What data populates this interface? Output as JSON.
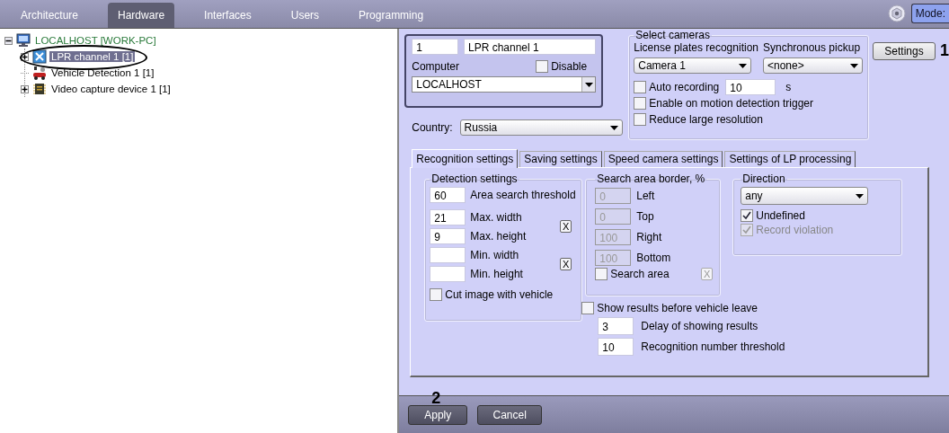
{
  "top_tabs": [
    {
      "label": "Architecture",
      "selected": false
    },
    {
      "label": "Hardware",
      "selected": true
    },
    {
      "label": "Interfaces",
      "selected": false
    },
    {
      "label": "Users",
      "selected": false
    },
    {
      "label": "Programming",
      "selected": false
    }
  ],
  "mode_button": {
    "label": "Mode:"
  },
  "tree": [
    {
      "label": "LOCALHOST [WORK-PC]",
      "kind": "computer",
      "expanded": true,
      "selected": false,
      "children": [
        {
          "label": "LPR channel 1 [1]",
          "kind": "lpr",
          "expandable": true,
          "expanded": false,
          "selected": true,
          "circled": true
        },
        {
          "label": "Vehicle Detection 1 [1]",
          "kind": "vehicle",
          "expandable": false,
          "selected": false,
          "circled": false
        },
        {
          "label": "Video capture device 1 [1]",
          "kind": "chip",
          "expandable": true,
          "expanded": false,
          "selected": false,
          "circled": false
        }
      ]
    }
  ],
  "object": {
    "number": "1",
    "name": "LPR channel 1",
    "computer_label": "Computer",
    "disable": {
      "label": "Disable",
      "checked": false
    },
    "computer": "LOCALHOST"
  },
  "country": {
    "label": "Country:",
    "value": "Russia"
  },
  "select_cameras": {
    "title": "Select cameras",
    "lpr_label": "License plates recognition",
    "lpr_value": "Camera 1",
    "sync_label": "Synchronous pickup",
    "sync_value": "<none>",
    "auto_recording": {
      "label": "Auto recording",
      "checked": false,
      "value": "10",
      "unit": "s"
    },
    "motion_trigger": {
      "label": "Enable on motion detection trigger",
      "checked": false
    },
    "reduce_resolution": {
      "label": "Reduce large resolution",
      "checked": false
    }
  },
  "settings_button": {
    "label": "Settings"
  },
  "settings_tabs": [
    {
      "label": "Recognition settings",
      "selected": true
    },
    {
      "label": "Saving settings",
      "selected": false
    },
    {
      "label": "Speed camera settings",
      "selected": false
    },
    {
      "label": "Settings of LP processing",
      "selected": false
    }
  ],
  "detection": {
    "title": "Detection settings",
    "area_threshold": {
      "value": "60",
      "label": "Area search threshold"
    },
    "max_width": {
      "value": "21",
      "label": "Max. width"
    },
    "max_height": {
      "value": "9",
      "label": "Max. height"
    },
    "max_clear": "X",
    "min_width": {
      "label": "Min. width"
    },
    "min_height": {
      "label": "Min. height"
    },
    "min_clear": "X",
    "cut_image": {
      "label": "Cut image with vehicle",
      "checked": false
    }
  },
  "search_area": {
    "title": "Search area border, %",
    "fields": [
      {
        "value": "0",
        "label": "Left",
        "disabled": true
      },
      {
        "value": "0",
        "label": "Top",
        "disabled": true
      },
      {
        "value": "100",
        "label": "Right",
        "disabled": true
      },
      {
        "value": "100",
        "label": "Bottom",
        "disabled": true
      }
    ],
    "enable": {
      "label": "Search area",
      "checked": false
    },
    "clear": {
      "label": "X",
      "disabled": true
    }
  },
  "direction": {
    "title": "Direction",
    "value": "any",
    "undefined": {
      "label": "Undefined",
      "checked": true,
      "disabled": false
    },
    "record_violation": {
      "label": "Record violation",
      "checked": true,
      "disabled": true
    }
  },
  "show_results": {
    "label": "Show results before vehicle leave",
    "checked": false
  },
  "delay": {
    "value": "3",
    "label": "Delay of showing results"
  },
  "threshold": {
    "value": "10",
    "label": "Recognition number threshold"
  },
  "buttons": [
    {
      "label": "Apply"
    },
    {
      "label": "Cancel"
    }
  ],
  "annotations": [
    {
      "label": "1"
    },
    {
      "label": "2"
    }
  ]
}
